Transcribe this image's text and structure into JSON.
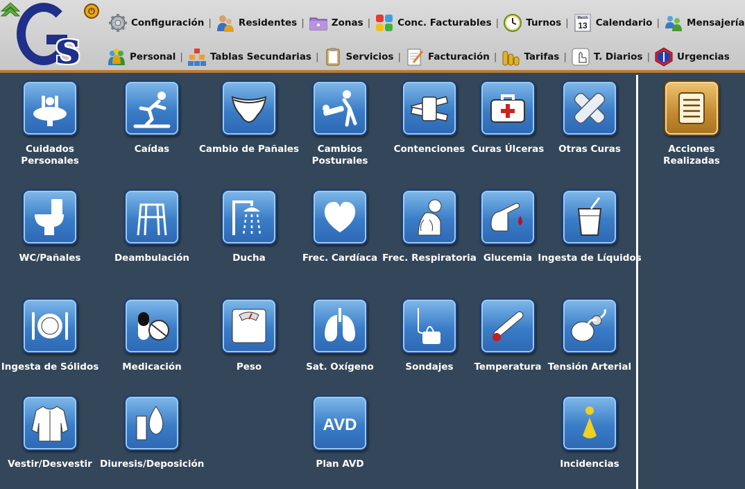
{
  "header": {
    "menu_row1": [
      {
        "label": "Configuración",
        "icon": "gear-icon"
      },
      {
        "label": "Residentes",
        "icon": "residents-icon"
      },
      {
        "label": "Zonas",
        "icon": "folder-icon"
      },
      {
        "label": "Conc. Facturables",
        "icon": "puzzle-icon"
      },
      {
        "label": "Turnos",
        "icon": "clock-icon"
      },
      {
        "label": "Calendario",
        "icon": "calendar-icon"
      },
      {
        "label": "Mensajería",
        "icon": "messaging-icon"
      }
    ],
    "menu_row2": [
      {
        "label": "Personal",
        "icon": "staff-icon"
      },
      {
        "label": "Tablas Secundarias",
        "icon": "tables-icon"
      },
      {
        "label": "Servicios",
        "icon": "clipboard-icon"
      },
      {
        "label": "Facturación",
        "icon": "invoice-icon"
      },
      {
        "label": "Tarifas",
        "icon": "coins-icon"
      },
      {
        "label": "T. Diarios",
        "icon": "touch-icon"
      },
      {
        "label": "Urgencias",
        "icon": "emergency-icon"
      }
    ],
    "calendar_month": "March",
    "calendar_day": "13",
    "separator": "|"
  },
  "logo": {
    "g": "G",
    "s": "s"
  },
  "tiles": [
    {
      "label": "Cuidados Personales",
      "icon": "sink-icon"
    },
    {
      "label": "Caídas",
      "icon": "falling-person-icon"
    },
    {
      "label": "Cambio de Pañales",
      "icon": "diaper-icon"
    },
    {
      "label": "Cambios Posturales",
      "icon": "posture-change-icon"
    },
    {
      "label": "Contenciones",
      "icon": "restraints-icon"
    },
    {
      "label": "Curas Úlceras",
      "icon": "first-aid-kit-icon"
    },
    {
      "label": "Otras Curas",
      "icon": "bandage-cross-icon"
    },
    {
      "label": "WC/Pañales",
      "icon": "toilet-icon"
    },
    {
      "label": "Deambulación",
      "icon": "walker-icon"
    },
    {
      "label": "Ducha",
      "icon": "shower-icon"
    },
    {
      "label": "Frec. Cardíaca",
      "icon": "heart-icon"
    },
    {
      "label": "Frec. Respiratoria",
      "icon": "respiration-icon"
    },
    {
      "label": "Glucemia",
      "icon": "blood-drop-finger-icon"
    },
    {
      "label": "Ingesta de Líquidos",
      "icon": "cup-straw-icon"
    },
    {
      "label": "Ingesta de Sólidos",
      "icon": "plate-cutlery-icon"
    },
    {
      "label": "Medicación",
      "icon": "pills-icon"
    },
    {
      "label": "Peso",
      "icon": "scale-icon"
    },
    {
      "label": "Sat. Oxígeno",
      "icon": "lungs-icon"
    },
    {
      "label": "Sondajes",
      "icon": "catheter-icon"
    },
    {
      "label": "Temperatura",
      "icon": "thermometer-icon"
    },
    {
      "label": "Tensión Arterial",
      "icon": "blood-pressure-icon"
    },
    {
      "label": "Vestir/Desvestir",
      "icon": "shirt-icon"
    },
    {
      "label": "Diuresis/Deposición",
      "icon": "lab-drop-icon"
    },
    {
      "label": "Plan AVD",
      "icon": "avd-icon",
      "icon_text": "AVD"
    },
    {
      "label": "Incidencias",
      "icon": "info-icon"
    }
  ],
  "side_tile": {
    "label": "Acciones Realizadas",
    "icon": "list-icon"
  },
  "colors": {
    "background": "#33465a",
    "tile_blue": "#3a7cc7",
    "tile_gold": "#c28a30",
    "accent": "#bb7b35",
    "logo_blue": "#1f2f8a"
  }
}
